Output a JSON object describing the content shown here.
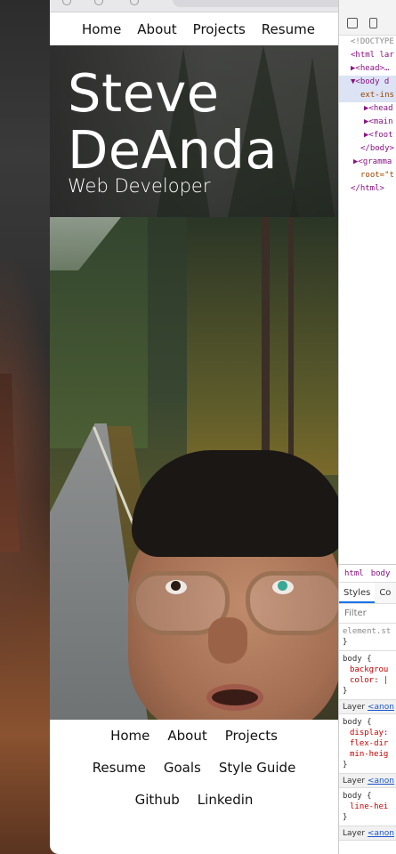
{
  "site": {
    "top_nav": [
      "Home",
      "About",
      "Projects",
      "Resume"
    ],
    "hero": {
      "title_line1": "Steve",
      "title_line2": "DeAnda",
      "subtitle": "Web Developer"
    },
    "footer_nav_rows": [
      [
        "Home",
        "About",
        "Projects"
      ],
      [
        "Resume",
        "Goals",
        "Style Guide"
      ],
      [
        "Github",
        "Linkedin"
      ]
    ]
  },
  "devtools": {
    "dom_lines": [
      {
        "text": "<!DOCTYPE",
        "kind": "dim"
      },
      {
        "text": "<html lar",
        "kind": "tag"
      },
      {
        "text": "▶<head>…",
        "kind": "tag"
      },
      {
        "text": "▼<body d",
        "kind": "tag",
        "selected": true
      },
      {
        "text": "ext-ins",
        "kind": "attr",
        "selected": true
      },
      {
        "text": "▶<head",
        "kind": "tag"
      },
      {
        "text": "▶<main",
        "kind": "tag"
      },
      {
        "text": "▶<foot",
        "kind": "tag"
      },
      {
        "text": "</body>",
        "kind": "tag"
      },
      {
        "text": "▶<gramma",
        "kind": "tag"
      },
      {
        "text": "root=\"t",
        "kind": "attr"
      },
      {
        "text": "</html>",
        "kind": "tag"
      }
    ],
    "breadcrumbs": [
      "html",
      "body"
    ],
    "tabs": [
      "Styles",
      "Co"
    ],
    "filter_placeholder": "Filter",
    "rules": [
      {
        "selector": "element.st",
        "props": [
          "}"
        ]
      },
      {
        "selector": "body {",
        "props": [
          "backgrou",
          "color: |",
          "}"
        ]
      }
    ],
    "layers": [
      {
        "label": "Layer",
        "link": "<anon",
        "selector": "body {",
        "props": [
          "display:",
          "flex-dir",
          "min-heig",
          "}"
        ]
      },
      {
        "label": "Layer",
        "link": "<anon",
        "selector": "body {",
        "props": [
          "line-hei",
          "}"
        ]
      },
      {
        "label": "Layer",
        "link": "<anon",
        "selector": "",
        "props": []
      }
    ]
  },
  "colors": {
    "link_text": "#111111",
    "selected_dom_bg": "#dbe3f5",
    "devtools_tag": "#881280",
    "devtools_prop": "#c80000"
  }
}
